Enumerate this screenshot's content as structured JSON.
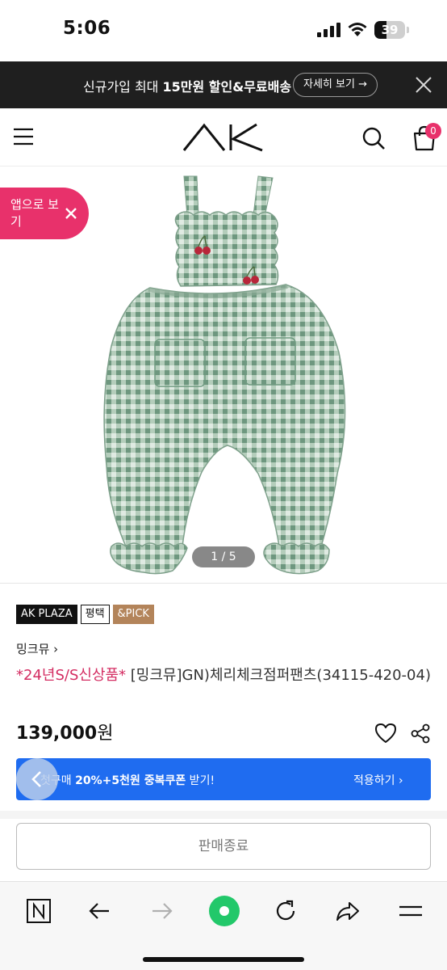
{
  "status": {
    "time": "5:06",
    "battery": "39",
    "battery_level": 0.39
  },
  "promo": {
    "text_prefix": "신규가입 최대 ",
    "text_bold": "15만원 할인&무료배송",
    "detail_label": "자세히 보기 →",
    "icons": {
      "close": "close-icon"
    }
  },
  "header": {
    "icons": {
      "menu": "menu-icon",
      "logo": "ak-logo",
      "search": "search-icon",
      "cart": "cart-icon"
    },
    "cart_count": "0"
  },
  "gallery": {
    "counter": "1 / 5",
    "app_pill": "앱으로 보기",
    "image_description_colors": {
      "fabric": "#a8c4b0",
      "check": "#6f9a80",
      "cherry": "#b8263a"
    }
  },
  "product": {
    "tags": [
      "AK PLAZA",
      "평택",
      "&PICK"
    ],
    "brand": "밍크뮤 ›",
    "title_highlight": "*24년S/S신상품*",
    "title_rest": " [밍크뮤]GN)체리체크점퍼팬츠(34115-420-04)",
    "price_amount": "139,000",
    "price_unit": "원",
    "icons": {
      "like": "heart-icon",
      "share": "share-icon"
    }
  },
  "coupon": {
    "text_prefix": "첫구매 ",
    "text_bold": "20%+5천원 중복쿠폰",
    "text_suffix": " 받기!",
    "apply_label": "적용하기 ›"
  },
  "actions": {
    "soldout_label": "판매종료"
  },
  "toolbar": {
    "icons": [
      "naver-n-icon",
      "back-arrow-icon",
      "forward-arrow-icon",
      "home-green-icon",
      "reload-icon",
      "share-icon",
      "menu-icon"
    ]
  },
  "colors": {
    "accent_pink": "#e8316b",
    "coupon_blue": "#1f6cf0",
    "banner_dark": "#1f1f1f",
    "tag_pick": "#b3845a"
  }
}
